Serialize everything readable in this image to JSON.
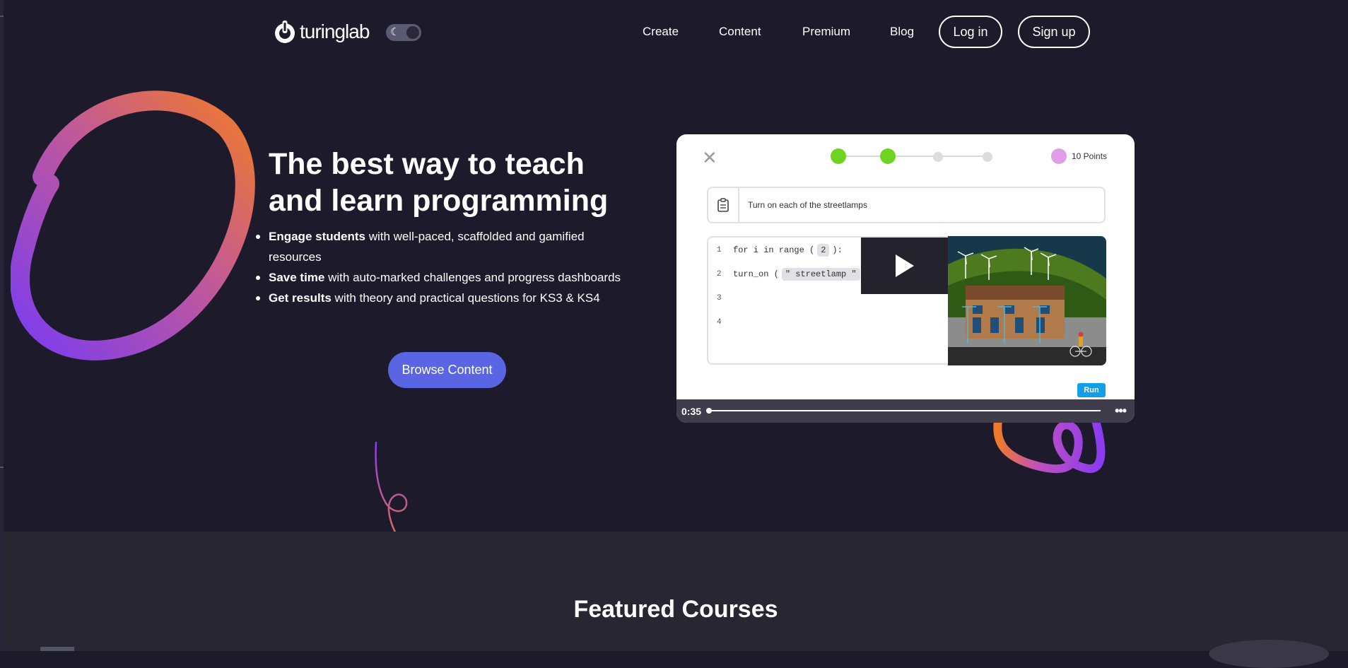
{
  "nav": {
    "logo_text": "turinglab",
    "links": [
      "Create",
      "Content",
      "Premium",
      "Blog"
    ],
    "login_label": "Log in",
    "signup_label": "Sign up",
    "theme_toggle_icon": "moon-icon"
  },
  "hero": {
    "title": "The best way to teach and learn programming",
    "features": [
      {
        "bold": "Engage students",
        "rest": " with well-paced, scaffolded and gamified resources"
      },
      {
        "bold": "Save time",
        "rest": " with auto-marked challenges and progress dashboards"
      },
      {
        "bold": "Get results",
        "rest": " with theory and practical questions for KS3 & KS4"
      }
    ],
    "cta_label": "Browse Content"
  },
  "video": {
    "points_label": "10 Points",
    "task_text": "Turn on each of the streetlamps",
    "progress": {
      "completed": 2,
      "total": 4
    },
    "code_lines": [
      "1",
      "2",
      "3",
      "4"
    ],
    "code": {
      "line1_a": "for i in range (",
      "line1_num": "2",
      "line1_b": "):",
      "line2_a": "turn_on (",
      "line2_str": "″ streetlamp ″",
      "line2_b": ")"
    },
    "run_label": "Run",
    "time": "0:35",
    "more_icon": "ellipsis-icon",
    "play_icon": "play-icon"
  },
  "featured": {
    "title": "Featured Courses"
  },
  "colors": {
    "background": "#1d1b2b",
    "cta": "#5965e2",
    "progress_done": "#6fd420",
    "run": "#129ee8"
  }
}
